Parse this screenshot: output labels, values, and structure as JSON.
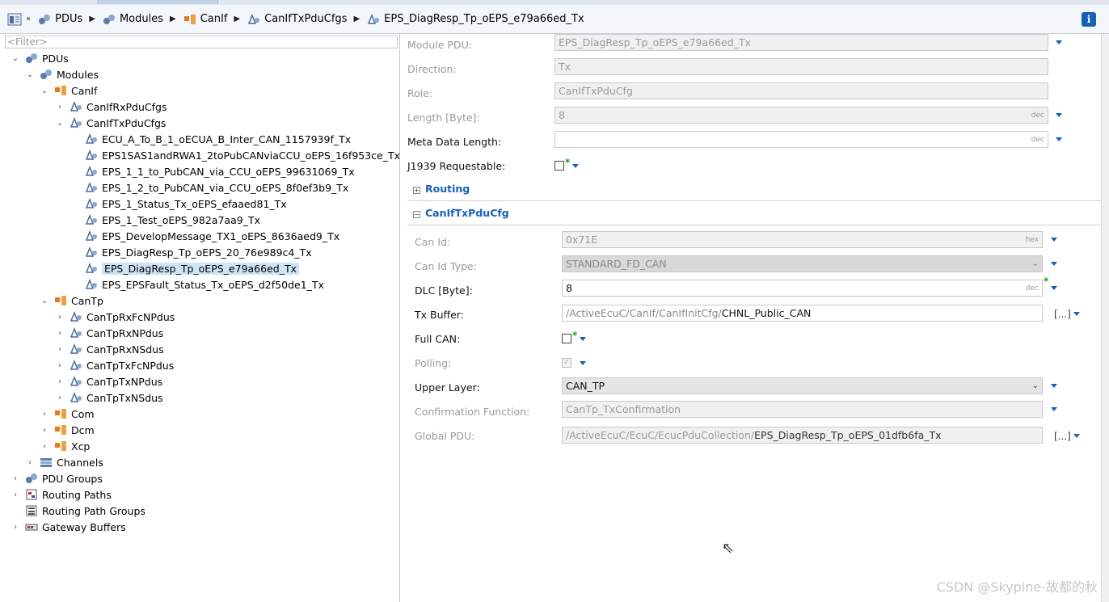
{
  "breadcrumb": {
    "items": [
      "PDUs",
      "Modules",
      "CanIf",
      "CanIfTxPduCfgs",
      "EPS_DiagResp_Tp_oEPS_e79a66ed_Tx"
    ]
  },
  "filter": {
    "placeholder": "<Filter>"
  },
  "tree": {
    "pdus": "PDUs",
    "modules": "Modules",
    "canif": "CanIf",
    "canifrx": "CanIfRxPduCfgs",
    "caniftx": "CanIfTxPduCfgs",
    "tx_items": [
      "ECU_A_To_B_1_oECUA_B_Inter_CAN_1157939f_Tx",
      "EPS1SAS1andRWA1_2toPubCANviaCCU_oEPS_16f953ce_Tx",
      "EPS_1_1_to_PubCAN_via_CCU_oEPS_99631069_Tx",
      "EPS_1_2_to_PubCAN_via_CCU_oEPS_8f0ef3b9_Tx",
      "EPS_1_Status_Tx_oEPS_efaaed81_Tx",
      "EPS_1_Test_oEPS_982a7aa9_Tx",
      "EPS_DevelopMessage_TX1_oEPS_8636aed9_Tx",
      "EPS_DiagResp_Tp_oEPS_20_76e989c4_Tx",
      "EPS_DiagResp_Tp_oEPS_e79a66ed_Tx",
      "EPS_EPSFault_Status_Tx_oEPS_d2f50de1_Tx"
    ],
    "cantp": "CanTp",
    "cantp_items": [
      "CanTpRxFcNPdus",
      "CanTpRxNPdus",
      "CanTpRxNSdus",
      "CanTpTxFcNPdus",
      "CanTpTxNPdus",
      "CanTpTxNSdus"
    ],
    "com": "Com",
    "dcm": "Dcm",
    "xcp": "Xcp",
    "channels": "Channels",
    "pdu_groups": "PDU Groups",
    "routing_paths": "Routing Paths",
    "routing_path_groups": "Routing Path Groups",
    "gateway_buffers": "Gateway Buffers"
  },
  "form": {
    "module_pdu_label": "Module PDU:",
    "module_pdu_value": "EPS_DiagResp_Tp_oEPS_e79a66ed_Tx",
    "direction_label": "Direction:",
    "direction_value": "Tx",
    "role_label": "Role:",
    "role_value": "CanIfTxPduCfg",
    "length_label": "Length [Byte]:",
    "length_value": "8",
    "length_unit": "dec",
    "meta_label": "Meta Data Length:",
    "meta_unit": "dec",
    "j1939_label": "J1939 Requestable:",
    "star": "*",
    "routing_section": "Routing",
    "caniftx_section": "CanIfTxPduCfg",
    "canid_label": "Can Id:",
    "canid_value": "0x71E",
    "canid_unit": "hex",
    "canidtype_label": "Can Id Type:",
    "canidtype_value": "STANDARD_FD_CAN",
    "dlc_label": "DLC [Byte]:",
    "dlc_value": "8",
    "dlc_unit": "dec",
    "txbuffer_label": "Tx Buffer:",
    "txbuffer_path": "/ActiveEcuC/CanIf/CanIfInitCfg/",
    "txbuffer_name": "CHNL_Public_CAN",
    "browse": "[...]",
    "fullcan_label": "Full CAN:",
    "polling_label": "Polling:",
    "polling_check": "✓",
    "upper_label": "Upper Layer:",
    "upper_value": "CAN_TP",
    "confirm_label": "Confirmation Function:",
    "confirm_value": "CanTp_TxConfirmation",
    "global_label": "Global PDU:",
    "global_path": "/ActiveEcuC/EcuC/EcucPduCollection/",
    "global_name": "EPS_DiagResp_Tp_oEPS_01dfb6fa_Tx"
  },
  "watermark": "CSDN @Skypine-故都的秋",
  "colors": {
    "accent": "#1660b8",
    "selection": "#cde4f7",
    "required": "#1c9d1c"
  }
}
